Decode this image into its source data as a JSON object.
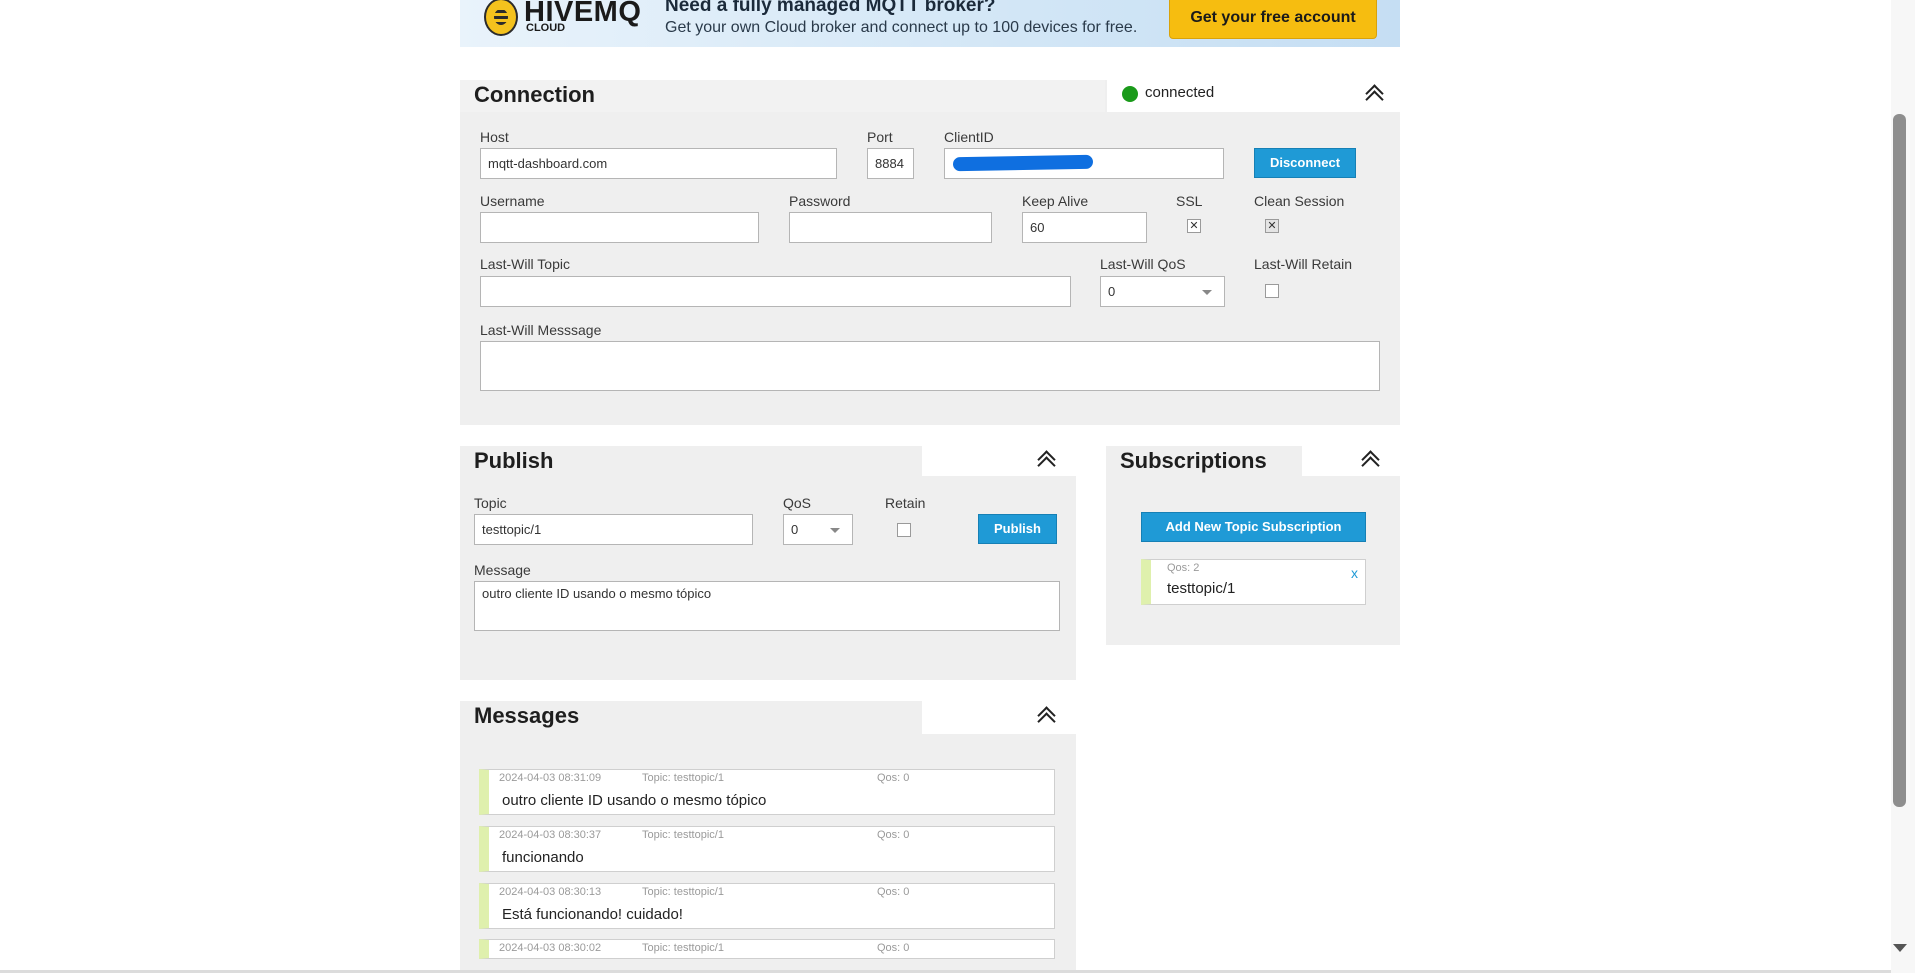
{
  "banner": {
    "logo_text": "HIVEMQ",
    "logo_sub": "CLOUD",
    "headline": "Need a fully managed MQTT broker?",
    "subline": "Get your own Cloud broker and connect up to 100 devices for free.",
    "cta_label": "Get your free account"
  },
  "connection": {
    "title": "Connection",
    "status": "connected",
    "status_color": "#1a9a1a",
    "host_label": "Host",
    "host_value": "mqtt-dashboard.com",
    "port_label": "Port",
    "port_value": "8884",
    "clientid_label": "ClientID",
    "disconnect_label": "Disconnect",
    "username_label": "Username",
    "username_value": "",
    "password_label": "Password",
    "password_value": "",
    "keepalive_label": "Keep Alive",
    "keepalive_value": "60",
    "ssl_label": "SSL",
    "ssl_checked": "✕",
    "clean_label": "Clean Session",
    "clean_checked": "✕",
    "lw_topic_label": "Last-Will Topic",
    "lw_topic_value": "",
    "lw_qos_label": "Last-Will QoS",
    "lw_qos_value": "0",
    "lw_retain_label": "Last-Will Retain",
    "lw_message_label": "Last-Will Messsage",
    "lw_message_value": ""
  },
  "publish": {
    "title": "Publish",
    "topic_label": "Topic",
    "topic_value": "testtopic/1",
    "qos_label": "QoS",
    "qos_value": "0",
    "retain_label": "Retain",
    "publish_label": "Publish",
    "message_label": "Message",
    "message_value": "outro cliente ID usando o mesmo tópico"
  },
  "subscriptions": {
    "title": "Subscriptions",
    "add_label": "Add New Topic Subscription",
    "items": [
      {
        "qos": "Qos: 2",
        "topic": "testtopic/1",
        "remove": "x"
      }
    ]
  },
  "messages": {
    "title": "Messages",
    "items": [
      {
        "time": "2024-04-03 08:31:09",
        "topic": "Topic: testtopic/1",
        "qos": "Qos: 0",
        "text": "outro cliente ID usando o mesmo tópico"
      },
      {
        "time": "2024-04-03 08:30:37",
        "topic": "Topic: testtopic/1",
        "qos": "Qos: 0",
        "text": "funcionando"
      },
      {
        "time": "2024-04-03 08:30:13",
        "topic": "Topic: testtopic/1",
        "qos": "Qos: 0",
        "text": "Está funcionando! cuidado!"
      },
      {
        "time": "2024-04-03 08:30:02",
        "topic": "Topic: testtopic/1",
        "qos": "Qos: 0",
        "text": ""
      }
    ]
  }
}
